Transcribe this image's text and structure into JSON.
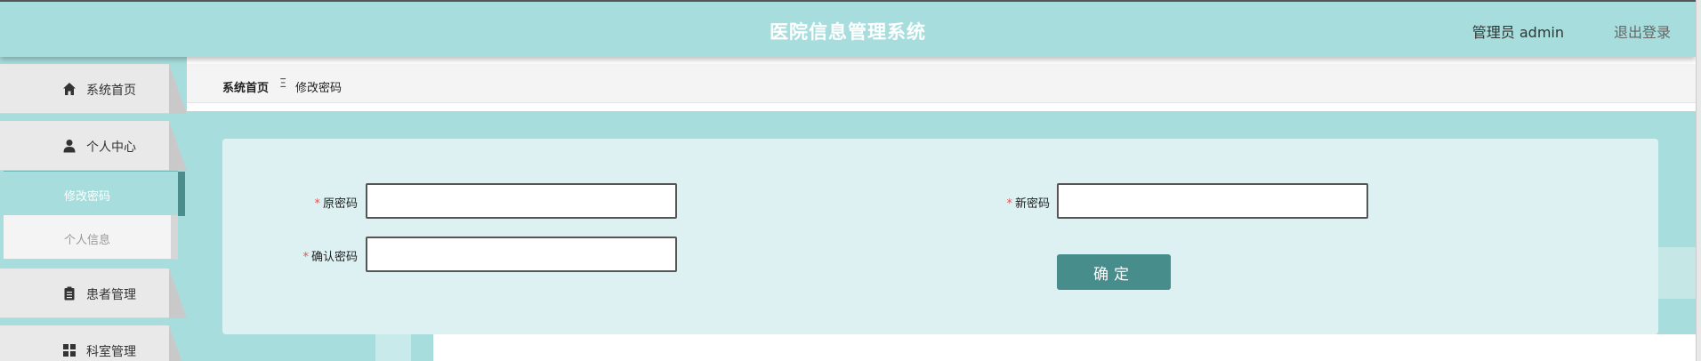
{
  "header": {
    "title": "医院信息管理系统",
    "user": "管理员 admin",
    "logout": "退出登录"
  },
  "sidebar": {
    "items": [
      {
        "label": "系统首页",
        "icon": "home-icon"
      },
      {
        "label": "个人中心",
        "icon": "user-icon"
      },
      {
        "label": "患者管理",
        "icon": "clipboard-icon"
      },
      {
        "label": "科室管理",
        "icon": "grid-icon"
      }
    ],
    "subitems": [
      {
        "label": "修改密码",
        "active": true
      },
      {
        "label": "个人信息",
        "active": false
      }
    ]
  },
  "breadcrumb": {
    "home": "系统首页",
    "separator": "Ξ",
    "current": "修改密码"
  },
  "form": {
    "old_password_label": "原密码",
    "new_password_label": "新密码",
    "confirm_password_label": "确认密码",
    "required_mark": "*",
    "old_password_value": "",
    "new_password_value": "",
    "confirm_password_value": "",
    "submit_label": "确定"
  },
  "colors": {
    "header_bg": "#a7dedd",
    "panel_bg": "#ddf1f2",
    "button_bg": "#468d8c",
    "required": "#e05555"
  }
}
